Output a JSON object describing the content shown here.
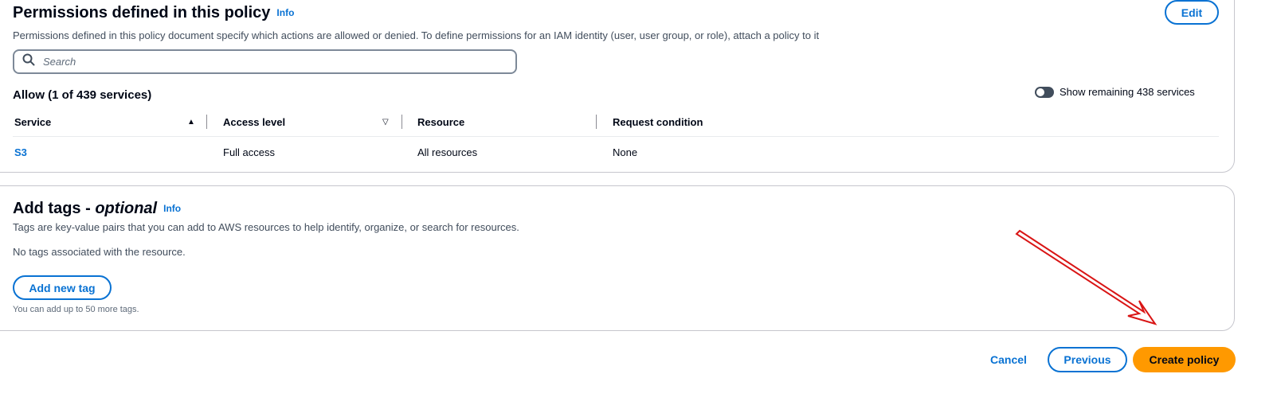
{
  "permissions": {
    "title": "Permissions defined in this policy",
    "info": "Info",
    "edit_label": "Edit",
    "description": "Permissions defined in this policy document specify which actions are allowed or denied. To define permissions for an IAM identity (user, user group, or role), attach a policy to it",
    "search_placeholder": "Search",
    "allow_title": "Allow (1 of 439 services)",
    "toggle_label": "Show remaining 438 services",
    "toggle_checked": false,
    "columns": [
      "Service",
      "Access level",
      "Resource",
      "Request condition"
    ],
    "rows": [
      {
        "service": "S3",
        "access_level": "Full access",
        "resource": "All resources",
        "request_condition": "None"
      }
    ]
  },
  "tags": {
    "title_main": "Add tags - ",
    "title_optional": "optional",
    "info": "Info",
    "description": "Tags are key-value pairs that you can add to AWS resources to help identify, organize, or search for resources.",
    "empty_text": "No tags associated with the resource.",
    "add_button": "Add new tag",
    "hint": "You can add up to 50 more tags."
  },
  "footer": {
    "cancel": "Cancel",
    "previous": "Previous",
    "create": "Create policy"
  },
  "colors": {
    "link_blue": "#0972d3",
    "primary_orange": "#ff9900",
    "annotation_red": "#d91515"
  },
  "icons": {
    "search": "search-icon",
    "sort_ascending": "sort-ascending-icon",
    "sort_descending": "sort-descending-icon"
  }
}
